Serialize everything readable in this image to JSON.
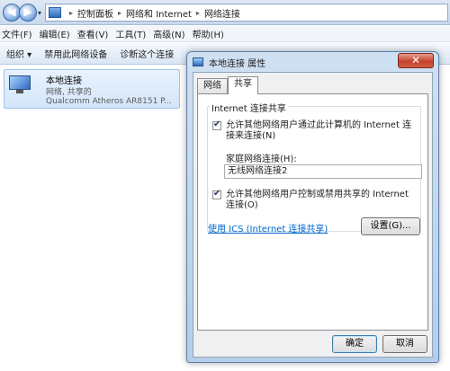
{
  "explorer": {
    "breadcrumb": [
      "控制面板",
      "网络和 Internet",
      "网络连接"
    ],
    "menu": [
      "文件(F)",
      "编辑(E)",
      "查看(V)",
      "工具(T)",
      "高级(N)",
      "帮助(H)"
    ],
    "toolbar": {
      "organize": "组织 ▾",
      "disable": "禁用此网络设备",
      "diagnose": "诊断这个连接"
    },
    "connection": {
      "name": "本地连接",
      "status": "网络, 共享的",
      "adapter": "Qualcomm Atheros AR8151 P..."
    }
  },
  "dialog": {
    "title": "本地连接 属性",
    "close": "✕",
    "tabs": [
      "网络",
      "共享"
    ],
    "group_title": "Internet 连接共享",
    "allow_connect": "允许其他网络用户通过此计算机的 Internet 连接来连接(N)",
    "home_label": "家庭网络连接(H):",
    "home_value": "无线网络连接2",
    "allow_control": "允许其他网络用户控制或禁用共享的 Internet 连接(O)",
    "ics_link": "使用 ICS (Internet 连接共享)",
    "settings": "设置(G)...",
    "ok": "确定",
    "cancel": "取消"
  }
}
